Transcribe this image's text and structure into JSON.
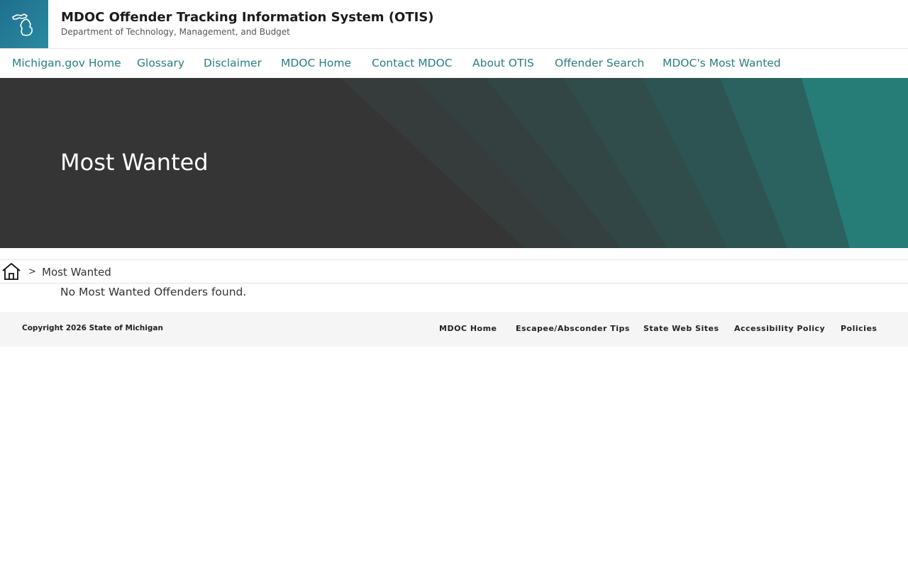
{
  "header": {
    "title": "MDOC Offender Tracking Information System (OTIS)",
    "subtitle": "Department of Technology, Management, and Budget",
    "logo_icon": "michigan-state-icon",
    "logo_color": "#1f7a94"
  },
  "nav": {
    "items": [
      {
        "label": "Michigan.gov Home"
      },
      {
        "label": "Glossary"
      },
      {
        "label": "Disclaimer"
      },
      {
        "label": "MDOC Home"
      },
      {
        "label": "Contact MDOC"
      },
      {
        "label": "About OTIS"
      },
      {
        "label": "Offender Search"
      },
      {
        "label": "MDOC's Most Wanted"
      }
    ],
    "link_color": "#2a7f7f"
  },
  "hero": {
    "title": "Most Wanted",
    "background_color": "#353535",
    "accent_color": "#267d78"
  },
  "breadcrumb": {
    "home_icon": "home-icon",
    "separator": ">",
    "current": "Most Wanted"
  },
  "main": {
    "message": "No Most Wanted Offenders found."
  },
  "footer": {
    "copyright": "Copyright 2026 State of Michigan",
    "links": [
      {
        "label": "MDOC Home"
      },
      {
        "label": "Escapee/Absconder Tips"
      },
      {
        "label": "State Web Sites"
      },
      {
        "label": "Accessibility Policy"
      },
      {
        "label": "Policies"
      }
    ]
  }
}
